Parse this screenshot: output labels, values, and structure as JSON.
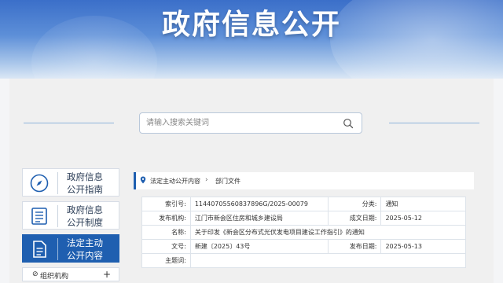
{
  "banner": {
    "title": "政府信息公开"
  },
  "search": {
    "placeholder": "请输入搜索关键词",
    "value": ""
  },
  "sidebar": {
    "items": [
      {
        "label_line1": "政府信息",
        "label_line2": "公开指南",
        "icon": "compass-icon",
        "active": false
      },
      {
        "label_line1": "政府信息",
        "label_line2": "公开制度",
        "icon": "list-document-icon",
        "active": false
      },
      {
        "label_line1": "法定主动",
        "label_line2": "公开内容",
        "icon": "document-icon",
        "active": true
      }
    ],
    "sub_items": [
      {
        "label": "组织机构",
        "icon": "org-icon"
      }
    ]
  },
  "breadcrumb": {
    "items": [
      "法定主动公开内容",
      "部门文件"
    ]
  },
  "info": {
    "rows": [
      {
        "k1": "索引号:",
        "v1": "11440705560837896G/2025-00079",
        "k2": "分类:",
        "v2": "通知"
      },
      {
        "k1": "发布机构:",
        "v1": "江门市新会区住房和城乡建设局",
        "k2": "成文日期:",
        "v2": "2025-05-12"
      },
      {
        "k1": "名称:",
        "v1": "关于印发《新会区分布式光伏发电项目建设工作指引》的通知"
      },
      {
        "k1": "文号:",
        "v1": "新建〔2025〕43号",
        "k2": "发布日期:",
        "v2": "2025-05-13"
      },
      {
        "k1": "主题词:",
        "v1": ""
      }
    ]
  },
  "colors": {
    "accent": "#1f5fb0",
    "banner_top": "#3b6fc9"
  }
}
